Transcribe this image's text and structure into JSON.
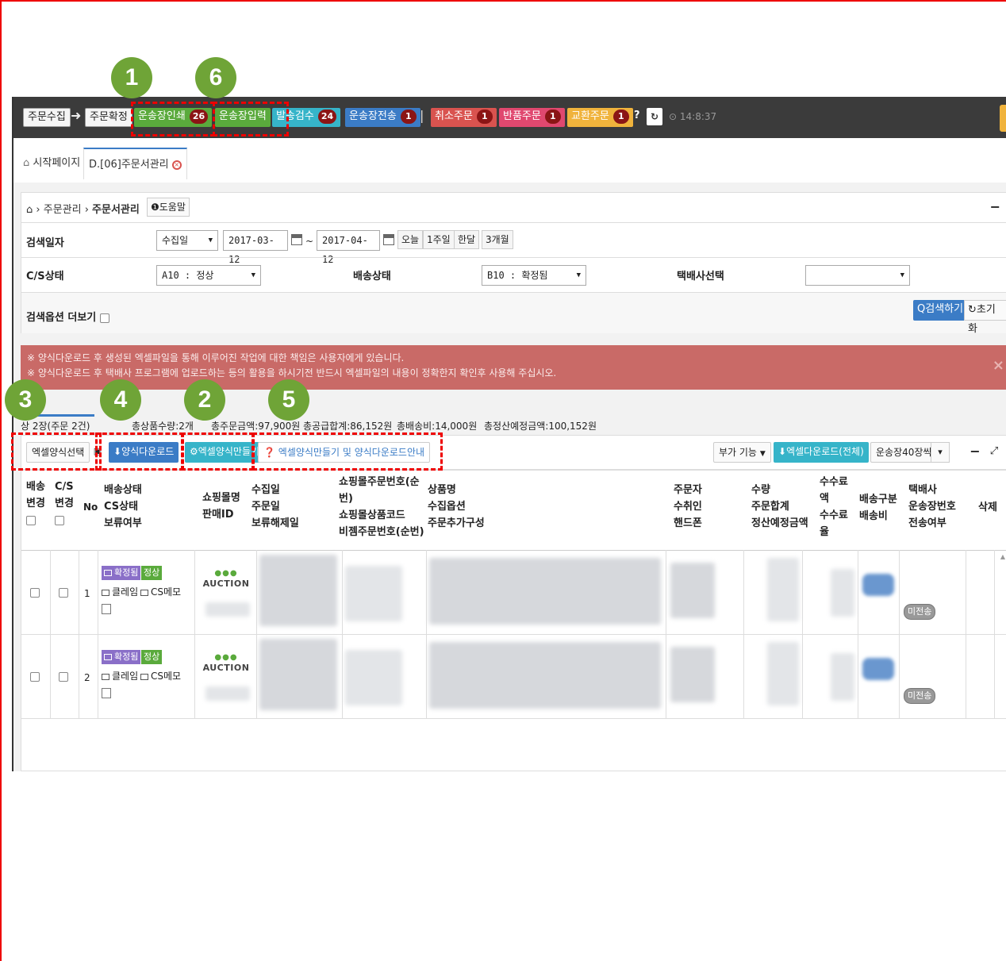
{
  "toolbar": {
    "order_collect": "주문수집",
    "order_confirm": "주문확정",
    "waybill_print": {
      "label": "운송장인쇄",
      "count": "26"
    },
    "waybill_input": {
      "label": "운송장입력"
    },
    "ship_check": {
      "label": "발송검수",
      "count": "24"
    },
    "waybill_send": {
      "label": "운송장전송",
      "count": "1"
    },
    "cancel_order": {
      "label": "취소주문",
      "count": "1"
    },
    "return_order": {
      "label": "반품주문",
      "count": "1"
    },
    "exchange_order": {
      "label": "교환주문",
      "count": "1"
    },
    "clock": "14:8:37"
  },
  "tabs": {
    "home": "시작페이지",
    "order_mgmt": "D.[06]주문서관리"
  },
  "search": {
    "breadcrumb_root": "주문관리",
    "breadcrumb_current": "주문서관리",
    "help": "도움말",
    "date_label": "검색일자",
    "date_type": "수집일",
    "date_from": "2017-03-12",
    "date_to": "2017-04-12",
    "range_today": "오늘",
    "range_week": "1주일",
    "range_month": "한달",
    "range_3month": "3개월",
    "cs_label": "C/S상태",
    "cs_value": "A10 : 정상",
    "ship_label": "배송상태",
    "ship_value": "B10 : 확정됨",
    "courier_label": "택배사선택",
    "courier_value": "",
    "more_options": "검색옵션 더보기",
    "search_btn": "검색하기",
    "reset_btn": "초기화"
  },
  "alert": {
    "line1": "※ 양식다운로드 후 생성된 엑셀파일을 통해 이루어진 작업에 대한 책임은 사용자에게 있습니다.",
    "line2": "※ 양식다운로드 후 택배사 프로그램에 업로드하는 등의 활용을 하시기전 반드시 엑셀파일의 내용이 정확한지 확인후 사용해 주십시오."
  },
  "summary": {
    "sheet": "상 2장(주문 2건)",
    "qty": "총상품수량:2개",
    "amount": "총주문금액:97,900원",
    "supply": "총공급합계:86,152원",
    "ship_fee": "총배송비:14,000원",
    "settle": "총정산예정금액:100,152원"
  },
  "gridbar": {
    "excel_select": "엑셀양식선택",
    "form_download": "양식다운로드",
    "excel_make": "엑셀양식만들기",
    "guide": "엑셀양식만들기 및 양식다운로드안내",
    "extra": "부가 기능",
    "excel_all": "엑셀다운로드(전체)",
    "waybill40": "운송장40장씩"
  },
  "table": {
    "headers": {
      "ship_change": [
        "배송",
        "변경"
      ],
      "cs_change": [
        "C/S",
        "변경"
      ],
      "no": "No",
      "status": [
        "배송상태",
        "CS상태",
        "보류여부"
      ],
      "mall": [
        "쇼핑몰명",
        "판매ID"
      ],
      "dates": [
        "수집일",
        "주문일",
        "보류해제일"
      ],
      "order_no": [
        "쇼핑몰주문번호(순",
        "번)",
        "쇼핑몰상품코드",
        "비젬주문번호(순번)"
      ],
      "product": [
        "상품명",
        "수집옵션",
        "주문추가구성"
      ],
      "buyer": [
        "주문자",
        "수취인",
        "핸드폰"
      ],
      "qty": [
        "수량",
        "주문합계",
        "정산예정금액"
      ],
      "fee": [
        "수수료",
        "액",
        "수수료",
        "율"
      ],
      "ship_type": [
        "배송구분",
        "배송비"
      ],
      "courier": [
        "택배사",
        "운송장번호",
        "전송여부"
      ],
      "delete": "삭제"
    },
    "rows": [
      {
        "no": "1",
        "ship_status": "확정됨",
        "cs_status": "정상",
        "claim": "클레임",
        "memo": "CS메모",
        "mall": "AUCTION",
        "sent": "미전송"
      },
      {
        "no": "2",
        "ship_status": "확정됨",
        "cs_status": "정상",
        "claim": "클레임",
        "memo": "CS메모",
        "mall": "AUCTION",
        "sent": "미전송"
      }
    ]
  },
  "callouts": [
    "1",
    "6",
    "3",
    "4",
    "2",
    "5"
  ],
  "colors": {
    "accent": "#3b7cc6",
    "callout": "#6fa437",
    "highlight": "#e00000",
    "alert": "#c96a67"
  }
}
